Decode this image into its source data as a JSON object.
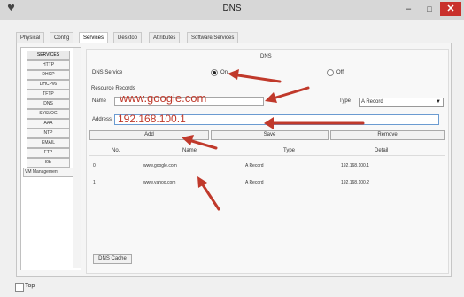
{
  "window": {
    "title": "DNS",
    "minimize_glyph": "–",
    "maximize_glyph": "□",
    "close_glyph": "✕",
    "app_icon": "packet-tracer-icon"
  },
  "tabs": [
    {
      "label": "Physical",
      "active": false
    },
    {
      "label": "Config",
      "active": false
    },
    {
      "label": "Services",
      "active": true
    },
    {
      "label": "Desktop",
      "active": false
    },
    {
      "label": "Attributes",
      "active": false
    },
    {
      "label": "Software/Services",
      "active": false
    }
  ],
  "services": {
    "header": "SERVICES",
    "items": [
      "HTTP",
      "DHCP",
      "DHCPv6",
      "TFTP",
      "DNS",
      "SYSLOG",
      "AAA",
      "NTP",
      "EMAIL",
      "FTP",
      "IoE",
      "VM Management"
    ]
  },
  "dns": {
    "heading": "DNS",
    "service_label": "DNS Service",
    "on_label": "On",
    "off_label": "Off",
    "service_on": true,
    "resource_records_label": "Resource Records",
    "name_label": "Name",
    "name_value": "www.google.com",
    "type_label": "Type",
    "type_value": "A Record",
    "address_label": "Address",
    "address_value": "192.168.100.1",
    "buttons": {
      "add": "Add",
      "save": "Save",
      "remove": "Remove"
    },
    "table": {
      "headers": [
        "No.",
        "Name",
        "Type",
        "Detail"
      ],
      "rows": [
        {
          "no": "0",
          "name": "www.google.com",
          "type": "A Record",
          "detail": "192.168.100.1"
        },
        {
          "no": "1",
          "name": "www.yahoo.com",
          "type": "A Record",
          "detail": "192.168.100.2"
        }
      ]
    },
    "dns_cache_label": "DNS Cache"
  },
  "footer": {
    "top_label": "Top",
    "top_checked": false
  },
  "colors": {
    "annotation_arrow": "#c0392b",
    "close_button": "#c9302c",
    "title_bar": "#d7d7d7"
  }
}
